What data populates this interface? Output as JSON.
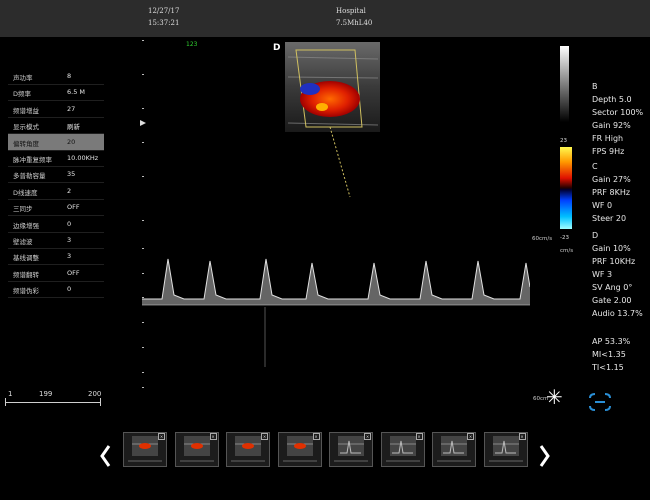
{
  "header": {
    "date": "12/27/17",
    "time": "15:37:21",
    "facility": "Hospital",
    "probe": "7.5MhL40"
  },
  "params": [
    {
      "label": "声功率",
      "value": "8"
    },
    {
      "label": "D频率",
      "value": "6.5 M"
    },
    {
      "label": "频谱增益",
      "value": "27"
    },
    {
      "label": "显示模式",
      "value": "刷新"
    },
    {
      "label": "偏转角度",
      "value": "20",
      "selected": true
    },
    {
      "label": "脉冲重复频率",
      "value": "10.00KHz"
    },
    {
      "label": "多普勒容量",
      "value": "35"
    },
    {
      "label": "D线速度",
      "value": "2"
    },
    {
      "label": "三同步",
      "value": "OFF"
    },
    {
      "label": "边缘增强",
      "value": "0"
    },
    {
      "label": "壁滤波",
      "value": "3"
    },
    {
      "label": "基线调整",
      "value": "3"
    },
    {
      "label": "频谱翻转",
      "value": "OFF"
    },
    {
      "label": "频谱伪彩",
      "value": "0"
    }
  ],
  "scrollbar": {
    "left": "1",
    "mid": "199",
    "right": "200"
  },
  "image": {
    "frame_counter": "123",
    "mode_marker": "D",
    "velocity_max": "23",
    "velocity_min": "-23",
    "velocity_unit_left": "60cm/s",
    "velocity_unit_right": "cm/s",
    "spectral_scale": "60cm"
  },
  "readouts": [
    "B",
    "Depth 5.0",
    "Sector 100%",
    "Gain 92%",
    "FR High",
    "FPS 9Hz",
    "C",
    "Gain  27%",
    "PRF 8KHz",
    "WF 0",
    "Steer 20",
    "D",
    "Gain  10%",
    "PRF 10KHz",
    "WF 3",
    "SV Ang 0°",
    "Gate 2.00",
    "Audio 13.7%",
    "AP 53.3%",
    "MI<1.35",
    "TI<1.15"
  ],
  "icons": {
    "sample_marker": "asterisk-icon",
    "cine": "cine-loop-icon",
    "prev": "chevron-left-icon",
    "next": "chevron-right-icon"
  },
  "thumbnail_count": 8
}
